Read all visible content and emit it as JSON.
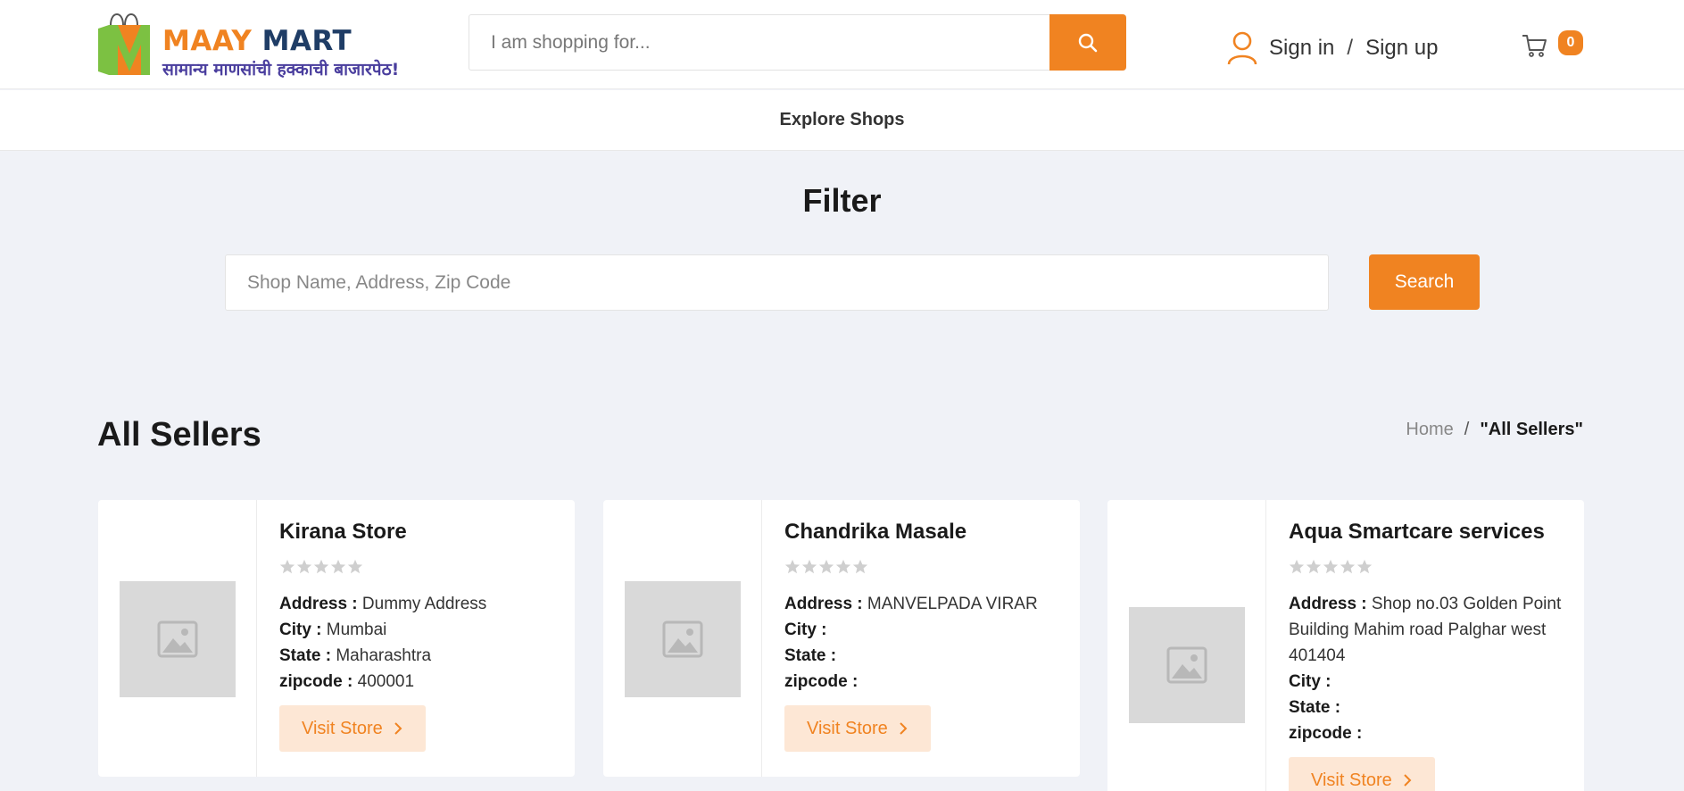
{
  "brand": {
    "name_part1": "MAAY",
    "name_part2": "MART",
    "tagline": "सामान्य माणसांची हक्काची बाजारपेठ!",
    "accent_color": "#f08321",
    "navy_color": "#1f3d66"
  },
  "header": {
    "search_placeholder": "I am shopping for...",
    "search_icon": "search-icon",
    "user_icon": "user-icon",
    "signin_label": "Sign in",
    "separator": "/",
    "signup_label": "Sign up",
    "cart_icon": "cart-icon",
    "cart_count": "0"
  },
  "nav": {
    "items": [
      {
        "label": "Explore Shops"
      }
    ]
  },
  "filter": {
    "title": "Filter",
    "placeholder": "Shop Name, Address, Zip Code",
    "button_label": "Search"
  },
  "sellers": {
    "title": "All Sellers",
    "breadcrumb": {
      "home": "Home",
      "separator": "/",
      "current": "\"All Sellers\""
    },
    "labels": {
      "address": "Address :",
      "city": "City :",
      "state": "State :",
      "zipcode": "zipcode :",
      "visit": "Visit Store"
    },
    "cards": [
      {
        "name": "Kirana Store",
        "rating": 0,
        "address": "Dummy Address",
        "city": "Mumbai",
        "state": "Maharashtra",
        "zipcode": "400001"
      },
      {
        "name": "Chandrika Masale",
        "rating": 0,
        "address": "MANVELPADA VIRAR",
        "city": "",
        "state": "",
        "zipcode": ""
      },
      {
        "name": "Aqua Smartcare services",
        "rating": 0,
        "address": "Shop no.03 Golden Point Building Mahim road Palghar west 401404",
        "city": "",
        "state": "",
        "zipcode": ""
      }
    ]
  }
}
